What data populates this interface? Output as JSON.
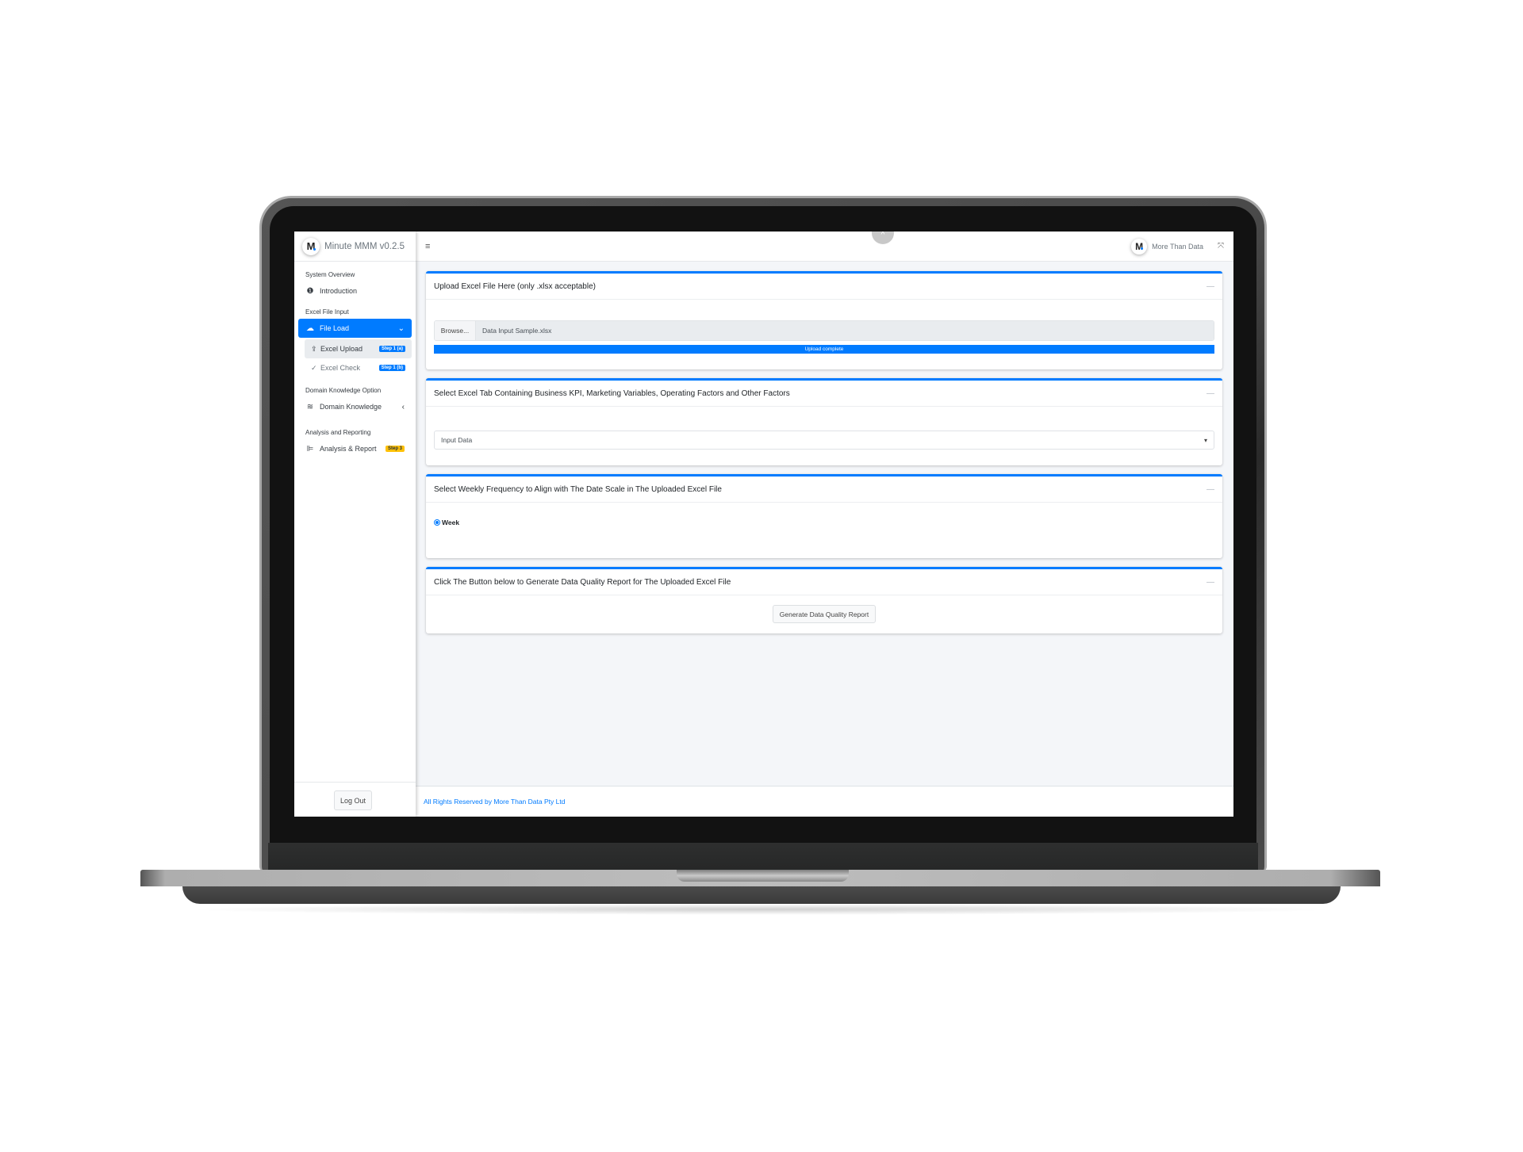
{
  "app": {
    "brand_title": "Minute MMM v0.2.5",
    "logo_letter": "M",
    "user_name": "More Than Data"
  },
  "sidebar": {
    "sections": [
      {
        "header": "System Overview"
      },
      {
        "header": "Excel File Input"
      },
      {
        "header": "Domain Knowledge Option"
      },
      {
        "header": "Analysis and Reporting"
      }
    ],
    "items": {
      "introduction": {
        "label": "Introduction",
        "icon": "info-circle-icon"
      },
      "file_load": {
        "label": "File Load",
        "icon": "cloud-upload-icon",
        "expanded": true
      },
      "excel_upload": {
        "label": "Excel Upload",
        "icon": "upload-icon",
        "badge": "Step 1 (a)"
      },
      "excel_check": {
        "label": "Excel Check",
        "icon": "check-icon",
        "badge": "Step 1 (b)"
      },
      "domain_knowledge": {
        "label": "Domain Knowledge",
        "icon": "layers-icon"
      },
      "analysis_report": {
        "label": "Analysis & Report",
        "icon": "chart-icon",
        "badge": "Step 3"
      }
    },
    "logout_label": "Log Out"
  },
  "icons": {
    "info": "❶",
    "cloud": "☁",
    "upload": "⇪",
    "check": "✓",
    "layers": "≋",
    "chart": "⊫",
    "chevron_down": "⌄",
    "chevron_left": "‹",
    "hamburger": "≡",
    "collapse_up": "^",
    "fullscreen": "⤧",
    "minimize": "—",
    "caret": "▾"
  },
  "main": {
    "cards": [
      {
        "title": "Upload Excel File Here (only .xlsx acceptable)",
        "browse_label": "Browse...",
        "file_name": "Data Input Sample.xlsx",
        "progress_label": "Upload complete",
        "progress_percent": 100
      },
      {
        "title": "Select Excel Tab Containing Business KPI, Marketing Variables, Operating Factors and Other Factors",
        "select_value": "Input Data"
      },
      {
        "title": "Select Weekly Frequency to Align with The Date Scale in The Uploaded Excel File",
        "radio_option": "Week",
        "radio_selected": true
      },
      {
        "title": "Click The Button below to Generate Data Quality Report for The Uploaded Excel File",
        "button_label": "Generate Data Quality Report"
      }
    ]
  },
  "footer": {
    "text": "All Rights Reserved by More Than Data Pty Ltd"
  },
  "colors": {
    "primary": "#007bff",
    "warning": "#ffc107",
    "background": "#f4f6f9"
  }
}
